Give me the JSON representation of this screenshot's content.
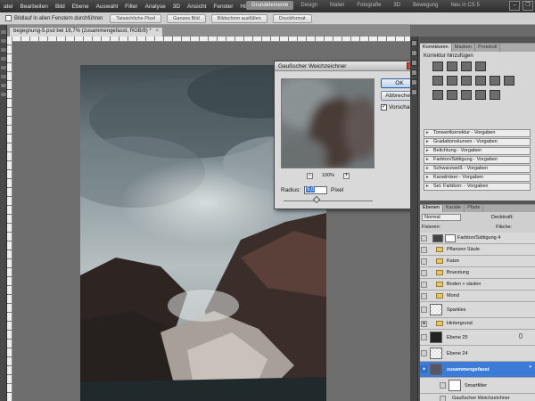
{
  "menu": {
    "items": [
      "atei",
      "Bearbeiten",
      "Bild",
      "Ebene",
      "Auswahl",
      "Filter",
      "Analyse",
      "3D",
      "Ansicht",
      "Fenster",
      "Hilfe"
    ],
    "workspaces": [
      "Grundelemente",
      "Design",
      "Malen",
      "Fotografie",
      "3D",
      "Bewegung",
      "Neu in CS 5"
    ]
  },
  "options": {
    "scroll_all_label": "Bildlauf in allen Fenstern durchführen",
    "actual_pixels": "Tatsächliche Pixel",
    "fit_screen": "Ganzes Bild",
    "fill_screen": "Bildschirm ausfüllen",
    "print_size": "Druckformat"
  },
  "document": {
    "tab_title": "begegnung-5.psd bei 16,7% (zusammengefasst, RGB/8) *",
    "close": "×"
  },
  "dialog": {
    "title": "Gaußscher Weichzeichner",
    "close": "x",
    "ok": "OK",
    "cancel": "Abbrechen",
    "preview_label": "Vorschau",
    "preview_checked": "✓",
    "zoom_out": "−",
    "zoom_in": "+",
    "zoom_value": "100%",
    "radius_label": "Radius:",
    "radius_value": "5,0",
    "radius_unit": "Pixel"
  },
  "adjustments": {
    "tabs": [
      "Korrekturen",
      "Masken",
      "Protokoll"
    ],
    "heading": "Korrektur hinzufügen",
    "presets": [
      "Tonwertkorrektur - Vorgaben",
      "Gradationskurven - Vorgaben",
      "Belichtung - Vorgaben",
      "Farbton/Sättigung - Vorgaben",
      "Schwarzweiß - Vorgaben",
      "Kanalmixer - Vorgaben",
      "Sel. Farbkorr. - Vorgaben"
    ]
  },
  "layers": {
    "tabs": [
      "Ebenen",
      "Kanäle",
      "Pfade"
    ],
    "blend_mode": "Normal",
    "opacity_label": "Deckkraft:",
    "lock_label": "Fixieren:",
    "fill_label": "Fläche:",
    "items": [
      {
        "name": "Farbton/Sättigung 4",
        "type": "adjustment"
      },
      {
        "name": "Pflanzen Säule",
        "type": "folder"
      },
      {
        "name": "Katze",
        "type": "folder"
      },
      {
        "name": "Bruestung",
        "type": "folder"
      },
      {
        "name": "Boden + säulen",
        "type": "folder"
      },
      {
        "name": "Mond",
        "type": "folder"
      },
      {
        "name": "Sparkles",
        "type": "layer"
      },
      {
        "name": "Hintergrund",
        "type": "folder"
      },
      {
        "name": "Ebene 25",
        "type": "layer"
      },
      {
        "name": "Ebene 24",
        "type": "layer"
      },
      {
        "name": "zusammengefasst",
        "type": "smart",
        "selected": true
      },
      {
        "name": "Smartfilter",
        "type": "filter-mask"
      }
    ],
    "filter_name": "Gaußscher Weichzeichner"
  }
}
